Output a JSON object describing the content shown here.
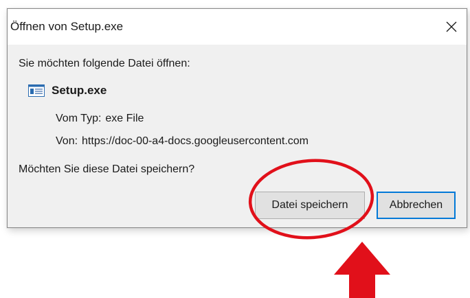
{
  "dialog": {
    "title": "Öffnen von Setup.exe",
    "prompt": "Sie möchten folgende Datei öffnen:",
    "file": {
      "name": "Setup.exe",
      "type_label": "Vom Typ:",
      "type_value": "exe File",
      "from_label": "Von:",
      "from_value": "https://doc-00-a4-docs.googleusercontent.com"
    },
    "question": "Möchten Sie diese Datei speichern?",
    "buttons": {
      "save_label": "Datei speichern",
      "cancel_label": "Abbrechen"
    },
    "icons": {
      "close": "close-icon",
      "file": "exe-file-icon"
    }
  },
  "annotations": {
    "highlight_color": "#e1101a",
    "shapes": [
      "ellipse-around-save-button",
      "arrow-pointing-up"
    ]
  },
  "colors": {
    "accent": "#0078d7",
    "client_bg": "#f0f0f0",
    "button_bg": "#e1e1e1"
  }
}
